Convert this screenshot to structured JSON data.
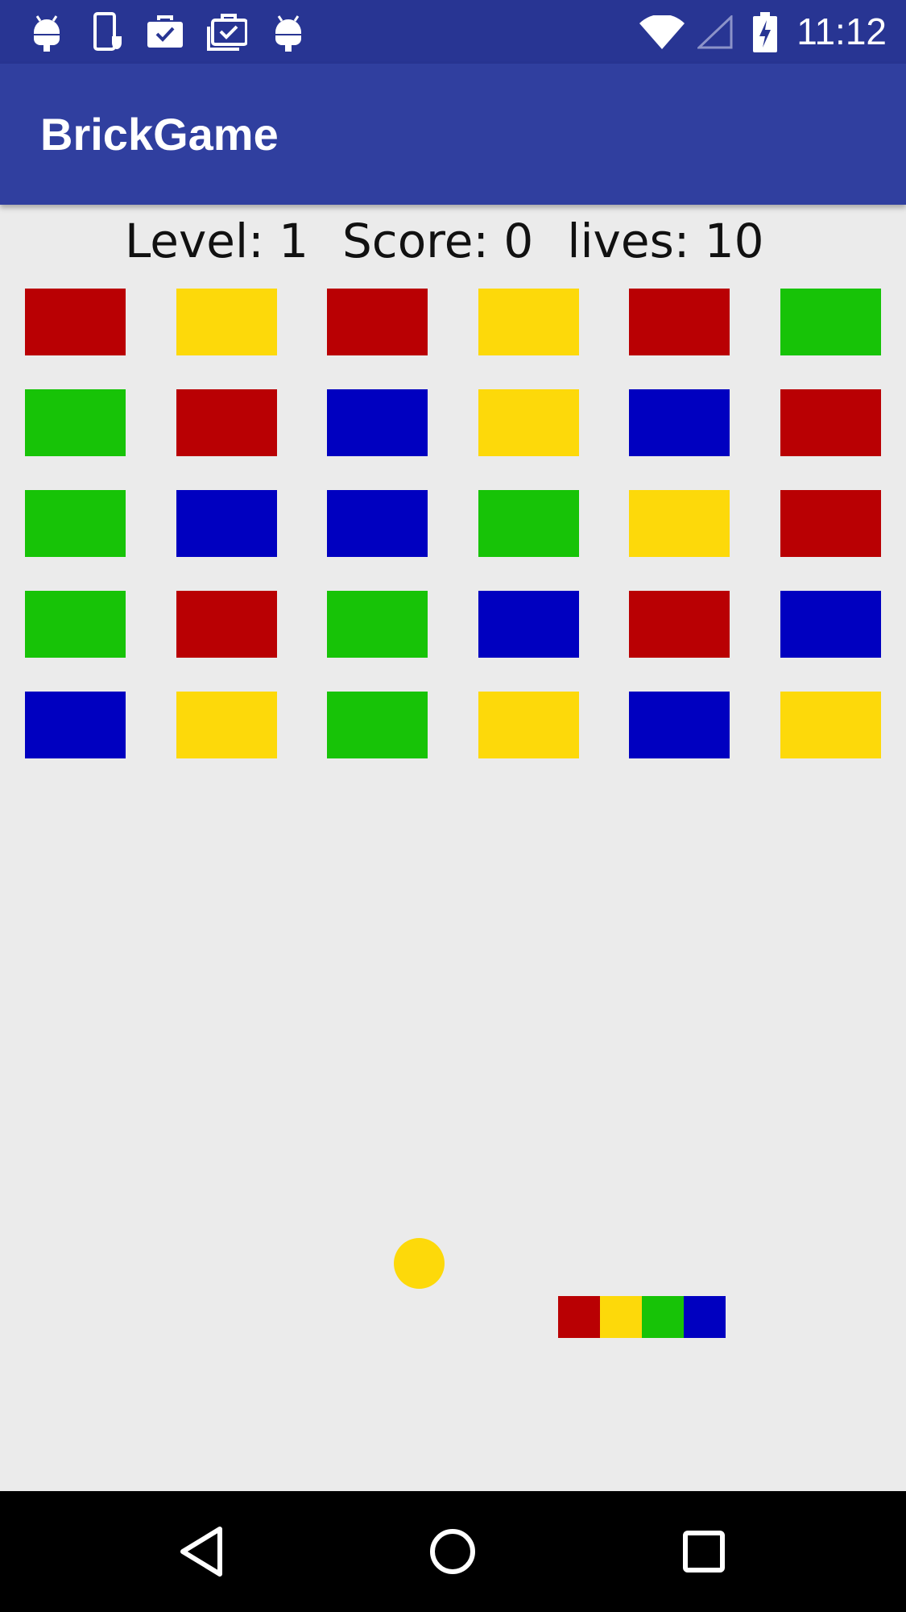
{
  "status_bar": {
    "time": "11:12",
    "left_icons": [
      "android-debug-icon",
      "phone-shield-icon",
      "briefcase-check-icon",
      "briefcase-stack-check-icon",
      "android-debug-icon"
    ],
    "right_icons": [
      "wifi-icon",
      "cell-signal-icon",
      "battery-charging-icon"
    ]
  },
  "app_bar": {
    "title": "BrickGame"
  },
  "hud": {
    "level_label": "Level:",
    "level_value": "1",
    "score_label": "Score:",
    "score_value": "0",
    "lives_label": "lives:",
    "lives_value": "10"
  },
  "colors": {
    "red": "#b90003",
    "yellow": "#fdd90a",
    "green": "#17c307",
    "blue": "#0000c0",
    "status_bar": "#283593",
    "app_bar": "#303f9f",
    "background": "#ebebeb"
  },
  "bricks": {
    "rows": [
      [
        "red",
        "yellow",
        "red",
        "yellow",
        "red",
        "green"
      ],
      [
        "green",
        "red",
        "blue",
        "yellow",
        "blue",
        "red"
      ],
      [
        "green",
        "blue",
        "blue",
        "green",
        "yellow",
        "red"
      ],
      [
        "green",
        "red",
        "green",
        "blue",
        "red",
        "blue"
      ],
      [
        "blue",
        "yellow",
        "green",
        "yellow",
        "blue",
        "yellow"
      ]
    ]
  },
  "ball": {
    "color": "yellow"
  },
  "paddle": {
    "segments": [
      "red",
      "yellow",
      "green",
      "blue"
    ]
  },
  "nav_bar": {
    "buttons": [
      "back-icon",
      "home-icon",
      "recents-icon"
    ]
  }
}
